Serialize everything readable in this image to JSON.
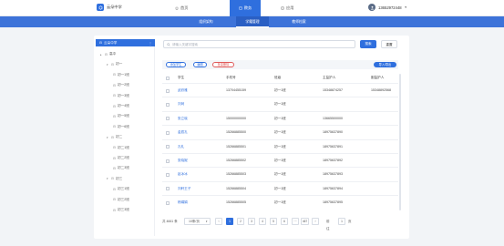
{
  "header": {
    "brand_name": "云朵中学",
    "nav_home": "首页",
    "nav_teaching": "教务",
    "nav_apps": "应用",
    "user_phone": "13652972448"
  },
  "subnav": {
    "tabs": [
      {
        "label": "组织架构"
      },
      {
        "label": "学籍管理"
      },
      {
        "label": "教师档案"
      }
    ]
  },
  "tree": {
    "root_label": "云朵中学",
    "root_more": "⋮",
    "items": [
      {
        "label": "高中",
        "level": 1,
        "expand": "▸"
      },
      {
        "label": "初一",
        "level": 2,
        "expand": "▾"
      },
      {
        "label": "初一1班",
        "level": 3
      },
      {
        "label": "初一2班",
        "level": 3
      },
      {
        "label": "初一3班",
        "level": 3
      },
      {
        "label": "初一4班",
        "level": 3
      },
      {
        "label": "初一5班",
        "level": 3
      },
      {
        "label": "初一6班",
        "level": 3
      },
      {
        "label": "初二",
        "level": 2,
        "expand": "▾"
      },
      {
        "label": "初二1班",
        "level": 3
      },
      {
        "label": "初二2班",
        "level": 3
      },
      {
        "label": "初二3班",
        "level": 3
      },
      {
        "label": "初三",
        "level": 2,
        "expand": "▾"
      },
      {
        "label": "初三1班",
        "level": 3
      },
      {
        "label": "初三2班",
        "level": 3
      },
      {
        "label": "初三3班",
        "level": 3
      }
    ]
  },
  "search": {
    "placeholder": "请输入关键字搜索",
    "search_label": "搜索",
    "reset_label": "重置"
  },
  "actions": {
    "add_student": "添加学生",
    "edit": "编辑",
    "bulk_delete": "批量删除",
    "import": "导入/导出"
  },
  "table": {
    "columns": [
      "学生",
      "手机号",
      "班级",
      "主监护人",
      "副监护人"
    ],
    "rows": [
      {
        "name": "武欣雅",
        "phone": "13704455159",
        "class": "初一1班",
        "guardian1": "15348874257",
        "guardian2": "15348892568"
      },
      {
        "name": "刘珂",
        "phone": "",
        "class": "初一1班",
        "guardian1": "",
        "guardian2": ""
      },
      {
        "name": "张立晓",
        "phone": "15000000000",
        "class": "初一1班",
        "guardian1": "13665500000",
        "guardian2": ""
      },
      {
        "name": "金辰孔",
        "phone": "15266885500",
        "class": "初一1班",
        "guardian1": "18975637890",
        "guardian2": ""
      },
      {
        "name": "孔礼",
        "phone": "15266885501",
        "class": "初一1班",
        "guardian1": "18975637891",
        "guardian2": ""
      },
      {
        "name": "张晓妮",
        "phone": "15266885502",
        "class": "初一1班",
        "guardian1": "18975637892",
        "guardian2": ""
      },
      {
        "name": "赵冰冰",
        "phone": "15266885503",
        "class": "初一1班",
        "guardian1": "18975637893",
        "guardian2": ""
      },
      {
        "name": "刘轩王子",
        "phone": "15266885504",
        "class": "初一1班",
        "guardian1": "18975637894",
        "guardian2": ""
      },
      {
        "name": "杨娟娟",
        "phone": "15266885505",
        "class": "初一1班",
        "guardian1": "18975637895",
        "guardian2": ""
      }
    ]
  },
  "pagination": {
    "total": "共 4661 条",
    "page_size": "10条/页",
    "prev": "‹",
    "pages": [
      "1",
      "2",
      "3",
      "4",
      "5",
      "6"
    ],
    "ellipsis": "···",
    "last": "467",
    "next": "›",
    "goto_label": "前往",
    "goto_value": "1",
    "page_unit": "页"
  },
  "colors": {
    "primary": "#2f6fde",
    "subnav": "#3d73d9",
    "danger": "#e05a5a"
  }
}
